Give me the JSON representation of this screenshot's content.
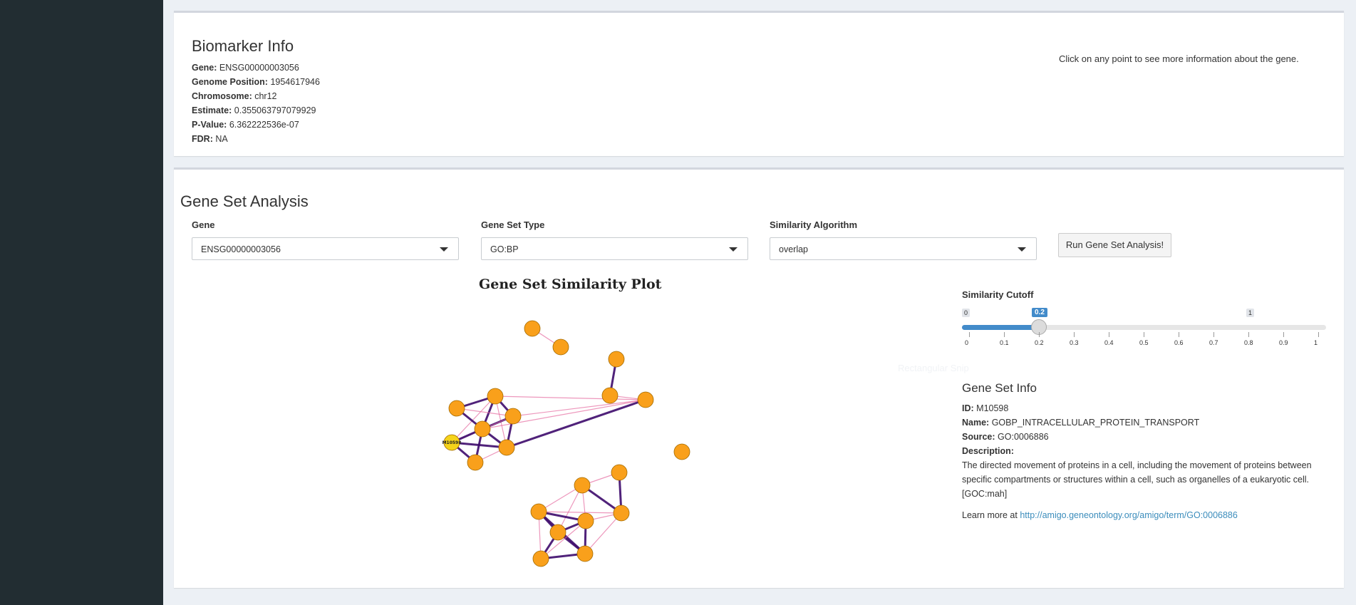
{
  "biomarker": {
    "title": "Biomarker Info",
    "fields": [
      {
        "label": "Gene:",
        "value": "ENSG00000003056"
      },
      {
        "label": "Genome Position:",
        "value": "1954617946"
      },
      {
        "label": "Chromosome:",
        "value": "chr12"
      },
      {
        "label": "Estimate:",
        "value": "0.355063797079929"
      },
      {
        "label": "P-Value:",
        "value": "6.362222536e-07"
      },
      {
        "label": "FDR:",
        "value": "NA"
      }
    ],
    "hint": "Click on any point to see more information about the gene."
  },
  "gsa": {
    "title": "Gene Set Analysis",
    "gene_label": "Gene",
    "gene_value": "ENSG00000003056",
    "type_label": "Gene Set Type",
    "type_value": "GO:BP",
    "algo_label": "Similarity Algorithm",
    "algo_value": "overlap",
    "run_button": "Run Gene Set Analysis!",
    "plot_title": "Gene Set Similarity Plot",
    "toolbar_hint": "Rectangular Snip",
    "slider": {
      "label": "Similarity Cutoff",
      "min": 0,
      "max": 1,
      "value": 0.2,
      "min_label": "0",
      "max_label": "1",
      "value_label": "0.2",
      "grid": [
        "0",
        "0.1",
        "0.2",
        "0.3",
        "0.4",
        "0.5",
        "0.6",
        "0.7",
        "0.8",
        "0.9",
        "1"
      ]
    },
    "info": {
      "title": "Gene Set Info",
      "id_label": "ID:",
      "id_value": "M10598",
      "name_label": "Name:",
      "name_value": "GOBP_INTRACELLULAR_PROTEIN_TRANSPORT",
      "source_label": "Source:",
      "source_value": "GO:0006886",
      "desc_label": "Description:",
      "desc_value": "The directed movement of proteins in a cell, including the movement of proteins between specific compartments or structures within a cell, such as organelles of a eukaryotic cell. [GOC:mah]",
      "learn_prefix": "Learn more at",
      "learn_link": "http://amigo.geneontology.org/amigo/term/GO:0006886"
    }
  },
  "network": {
    "node_color": "#f9a01b",
    "highlight_color": "#f5d31a",
    "edge_strong": "#3d0a6b",
    "edge_weak": "#e56b9f",
    "highlighted": "M10598"
  }
}
